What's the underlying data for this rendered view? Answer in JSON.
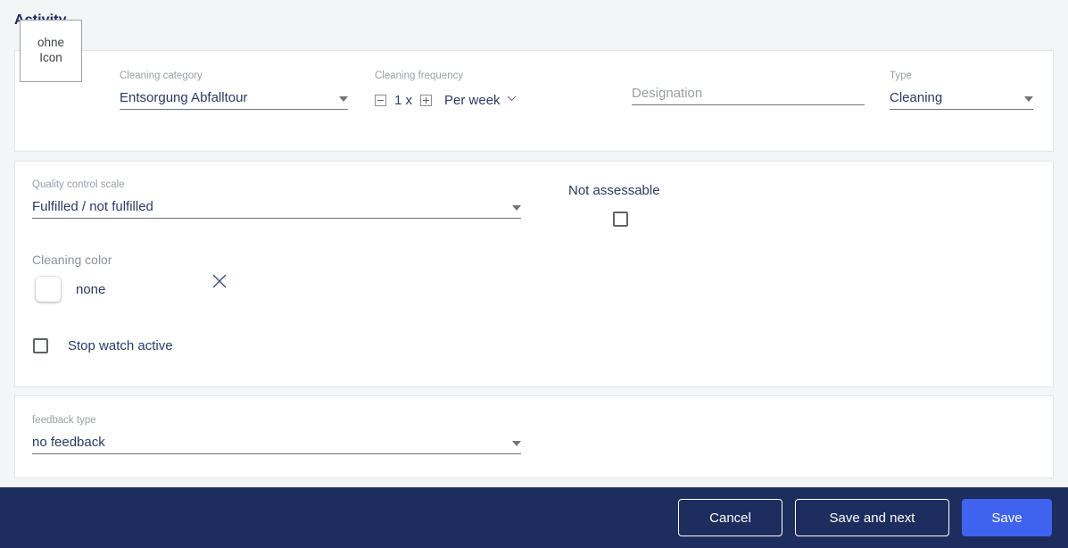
{
  "page": {
    "title": "Activity",
    "accent_blue": "#3f63ef",
    "footer_navy": "#1d2d5e",
    "background": "#f4f5f7"
  },
  "activity_card": {
    "icon_placeholder": {
      "line1": "ohne",
      "line2": "Icon"
    },
    "cleaning_category": {
      "label": "Cleaning category",
      "value": "Entsorgung Abfalltour"
    },
    "cleaning_frequency": {
      "label": "Cleaning frequency",
      "count": "1 x",
      "period": "Per week",
      "decrement": "−",
      "increment": "+"
    },
    "designation": {
      "label": "",
      "placeholder": "Designation",
      "value": ""
    },
    "type": {
      "label": "Type",
      "value": "Cleaning"
    }
  },
  "quality_card": {
    "quality_control_scale": {
      "label": "Quality control scale",
      "value": "Fulfilled / not fulfilled"
    },
    "not_assessable": {
      "label": "Not assessable",
      "checked": false
    },
    "cleaning_color": {
      "label": "Cleaning color",
      "value": "none",
      "swatch_color": "#ffffff"
    },
    "stop_watch_active": {
      "label": "Stop watch active",
      "checked": false
    }
  },
  "feedback_card": {
    "feedback_type": {
      "label": "feedback type",
      "value": "no feedback"
    }
  },
  "footer": {
    "cancel_label": "Cancel",
    "save_and_next_label": "Save and next",
    "save_label": "Save"
  }
}
